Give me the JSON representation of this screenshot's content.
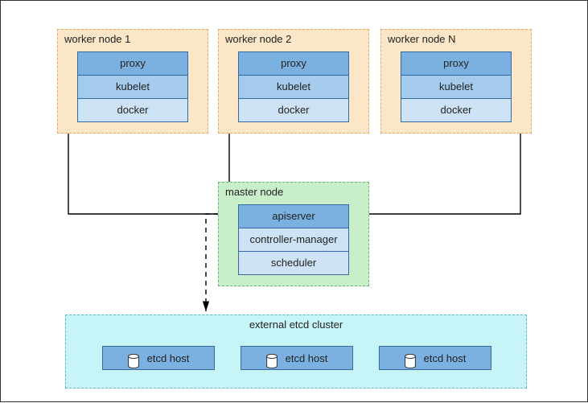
{
  "workers": [
    {
      "title": "worker node 1",
      "components": [
        "proxy",
        "kubelet",
        "docker"
      ]
    },
    {
      "title": "worker node 2",
      "components": [
        "proxy",
        "kubelet",
        "docker"
      ]
    },
    {
      "title": "worker node N",
      "components": [
        "proxy",
        "kubelet",
        "docker"
      ]
    }
  ],
  "master": {
    "title": "master node",
    "components": [
      "apiserver",
      "controller-manager",
      "scheduler"
    ]
  },
  "etcd": {
    "title": "external etcd cluster",
    "hosts": [
      "etcd host",
      "etcd host",
      "etcd host"
    ]
  },
  "colors": {
    "worker_bg": "#fbe6c8",
    "master_bg": "#c9eeca",
    "etcd_bg": "#c7f4f7",
    "comp_dark": "#7bb1e0",
    "comp_mid": "#a4cbec",
    "comp_light": "#cde2f4",
    "comp_border": "#356aa0"
  }
}
